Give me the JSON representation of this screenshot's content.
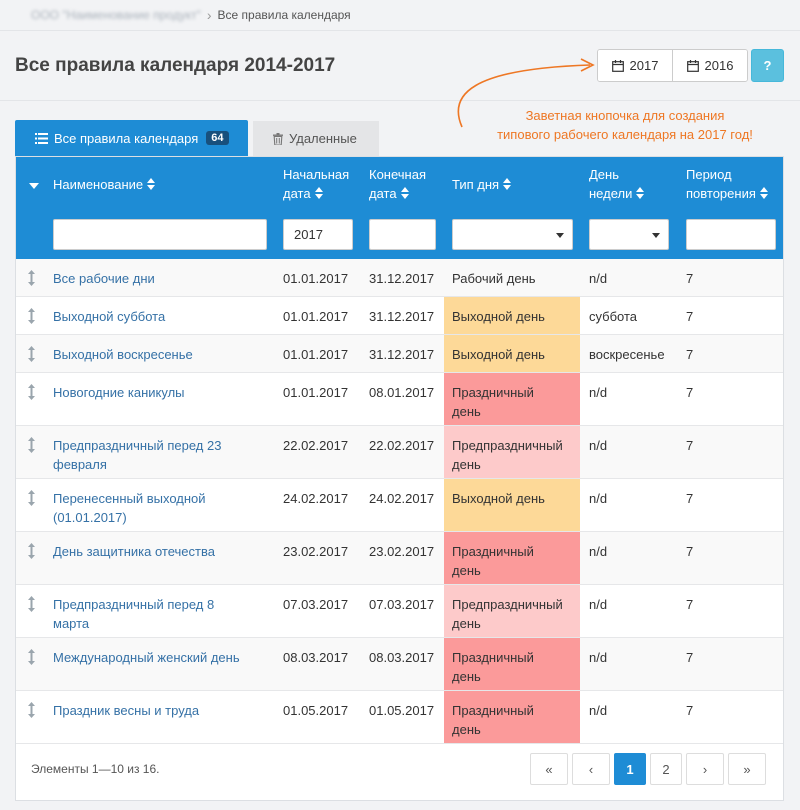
{
  "breadcrumb": {
    "org": "ООО \"Наименование продукт\"",
    "current": "Все правила календаря"
  },
  "page_title": "Все правила календаря 2014-2017",
  "year_buttons": [
    {
      "label": "2017"
    },
    {
      "label": "2016"
    }
  ],
  "help_label": "?",
  "callout": {
    "line1": "Заветная кнопочка для создания",
    "line2": "типового рабочего календаря на 2017 год!",
    "color": "#ee7724"
  },
  "tabs": [
    {
      "label": "Все правила календаря",
      "badge": "64"
    },
    {
      "label": "Удаленные"
    }
  ],
  "columns": {
    "name": "Наименование",
    "start_line1": "Начальная",
    "start_line2": "дата",
    "end_line1": "Конечная",
    "end_line2": "дата",
    "type": "Тип дня",
    "weekday_line1": "День",
    "weekday_line2": "недели",
    "period_line1": "Период",
    "period_line2": "повторения"
  },
  "filters": {
    "name": "",
    "start": "2017",
    "end": "",
    "type": "",
    "weekday": "",
    "period": ""
  },
  "rows": [
    {
      "name1": "Все рабочие дни",
      "name2": "",
      "start": "01.01.2017",
      "end": "31.12.2017",
      "type1": "Рабочий день",
      "type2": "",
      "weekday": "n/d",
      "period": "7"
    },
    {
      "name1": "Выходной суббота",
      "name2": "",
      "start": "01.01.2017",
      "end": "31.12.2017",
      "type1": "Выходной день",
      "type2": "",
      "weekday": "суббота",
      "period": "7"
    },
    {
      "name1": "Выходной воскресенье",
      "name2": "",
      "start": "01.01.2017",
      "end": "31.12.2017",
      "type1": "Выходной день",
      "type2": "",
      "weekday": "воскресенье",
      "period": "7"
    },
    {
      "name1": "Новогодние каникулы",
      "name2": "",
      "start": "01.01.2017",
      "end": "08.01.2017",
      "type1": "Праздничный",
      "type2": "день",
      "weekday": "n/d",
      "period": "7"
    },
    {
      "name1": "Предпраздничный перед 23",
      "name2": "февраля",
      "start": "22.02.2017",
      "end": "22.02.2017",
      "type1": "Предпраздничный",
      "type2": "день",
      "weekday": "n/d",
      "period": "7"
    },
    {
      "name1": "Перенесенный выходной",
      "name2": "(01.01.2017)",
      "start": "24.02.2017",
      "end": "24.02.2017",
      "type1": "Выходной день",
      "type2": "",
      "weekday": "n/d",
      "period": "7"
    },
    {
      "name1": "День защитника отечества",
      "name2": "",
      "start": "23.02.2017",
      "end": "23.02.2017",
      "type1": "Праздничный",
      "type2": "день",
      "weekday": "n/d",
      "period": "7"
    },
    {
      "name1": "Предпраздничный перед 8",
      "name2": "марта",
      "start": "07.03.2017",
      "end": "07.03.2017",
      "type1": "Предпраздничный",
      "type2": "день",
      "weekday": "n/d",
      "period": "7"
    },
    {
      "name1": "Международный женский день",
      "name2": "",
      "start": "08.03.2017",
      "end": "08.03.2017",
      "type1": "Праздничный",
      "type2": "день",
      "weekday": "n/d",
      "period": "7"
    },
    {
      "name1": "Праздник весны и труда",
      "name2": "",
      "start": "01.05.2017",
      "end": "01.05.2017",
      "type1": "Праздничный",
      "type2": "день",
      "weekday": "n/d",
      "period": "7"
    }
  ],
  "day_type_colors": {
    "Рабочий день": "",
    "Выходной день": "#fdd998",
    "Праздничный": "#fb9a9a",
    "Предпраздничный": "#fdcaca"
  },
  "footer": "Элементы 1—10 из 16.",
  "pagination": [
    "«",
    "‹",
    "1",
    "2",
    "›",
    "»"
  ]
}
